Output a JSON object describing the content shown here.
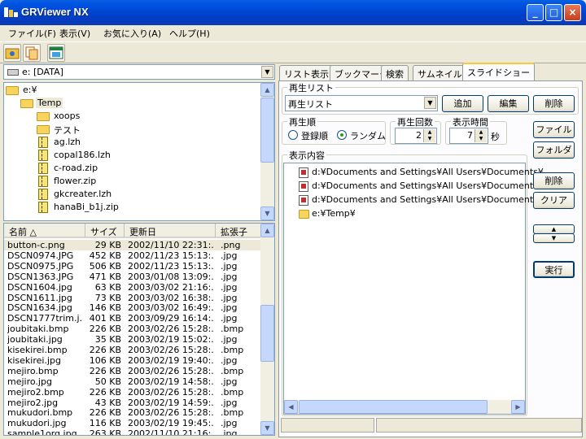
{
  "window": {
    "title": "GRViewer NX",
    "minimize": "_",
    "maximize": "□",
    "close": "×"
  },
  "menu": [
    "ファイル(F)",
    "表示(V)",
    "お気に入り(A)",
    "ヘルプ(H)"
  ],
  "drive": {
    "value": "e: [DATA]"
  },
  "tree": [
    {
      "label": "e:¥",
      "icon": "folder-icon"
    },
    {
      "label": "Temp",
      "icon": "folder-icon"
    },
    {
      "label": "xoops",
      "icon": "folder-icon"
    },
    {
      "label": "テスト",
      "icon": "folder-icon"
    },
    {
      "label": "ag.lzh",
      "icon": "archive-icon"
    },
    {
      "label": "copal186.lzh",
      "icon": "archive-icon"
    },
    {
      "label": "c-road.zip",
      "icon": "archive-icon"
    },
    {
      "label": "flower.zip",
      "icon": "archive-icon"
    },
    {
      "label": "gkcreater.lzh",
      "icon": "archive-icon"
    },
    {
      "label": "hanaBi_b1j.zip",
      "icon": "archive-icon"
    }
  ],
  "filelist": {
    "headers": [
      "名前 △",
      "サイズ",
      "更新日",
      "拡張子"
    ],
    "rows": [
      [
        "button-c.png",
        "29 KB",
        "2002/11/10 22:31:...",
        ".png"
      ],
      [
        "DSCN0974.JPG",
        "452 KB",
        "2002/11/23 15:13:...",
        ".jpg"
      ],
      [
        "DSCN0975.JPG",
        "506 KB",
        "2002/11/23 15:13:...",
        ".jpg"
      ],
      [
        "DSCN1363.JPG",
        "471 KB",
        "2003/01/08 13:09:...",
        ".jpg"
      ],
      [
        "DSCN1604.jpg",
        "63 KB",
        "2003/03/02 21:16:...",
        ".jpg"
      ],
      [
        "DSCN1611.jpg",
        "73 KB",
        "2003/03/02 16:38:...",
        ".jpg"
      ],
      [
        "DSCN1634.jpg",
        "146 KB",
        "2003/03/02 16:49:...",
        ".jpg"
      ],
      [
        "DSCN1777trim.j...",
        "401 KB",
        "2003/09/29 16:14:...",
        ".jpg"
      ],
      [
        "joubitaki.bmp",
        "226 KB",
        "2003/02/26 15:28:...",
        ".bmp"
      ],
      [
        "joubitaki.jpg",
        "35 KB",
        "2003/02/19 15:02:...",
        ".jpg"
      ],
      [
        "kisekirei.bmp",
        "226 KB",
        "2003/02/26 15:28:...",
        ".bmp"
      ],
      [
        "kisekirei.jpg",
        "106 KB",
        "2003/02/19 19:40:...",
        ".jpg"
      ],
      [
        "mejiro.bmp",
        "226 KB",
        "2003/02/26 15:28:...",
        ".bmp"
      ],
      [
        "mejiro.jpg",
        "50 KB",
        "2003/02/19 14:58:...",
        ".jpg"
      ],
      [
        "mejiro2.bmp",
        "226 KB",
        "2003/02/26 15:28:...",
        ".bmp"
      ],
      [
        "mejiro2.jpg",
        "43 KB",
        "2003/02/19 14:59:...",
        ".jpg"
      ],
      [
        "mukudori.bmp",
        "226 KB",
        "2003/02/26 15:28:...",
        ".bmp"
      ],
      [
        "mukudori.jpg",
        "116 KB",
        "2003/02/19 19:45:...",
        ".jpg"
      ],
      [
        "sample1org.jpg",
        "263 KB",
        "2002/11/10 21:16:...",
        ".jpg"
      ]
    ]
  },
  "tabs": [
    "リスト表示",
    "ブックマーク",
    "検索",
    "サムネイル",
    "スライドショー"
  ],
  "slideshow": {
    "playlist_group": "再生リスト",
    "playlist_value": "再生リスト",
    "add": "追加",
    "edit": "編集",
    "delete": "削除",
    "order_group": "再生順",
    "order_registration": "登録順",
    "order_random": "ランダム",
    "count_group": "再生回数",
    "count_value": "2",
    "time_group": "表示時間",
    "time_value": "7",
    "time_unit": "秒",
    "file": "ファイル",
    "folder": "フォルダ",
    "content_group": "表示内容",
    "content_items": [
      "d:¥Documents and Settings¥All Users¥Documents¥",
      "d:¥Documents and Settings¥All Users¥Documents¥",
      "d:¥Documents and Settings¥All Users¥Documents¥",
      "e:¥Temp¥"
    ],
    "remove": "削除",
    "clear": "クリア",
    "up": "▲",
    "down": "▼",
    "run": "実行"
  }
}
